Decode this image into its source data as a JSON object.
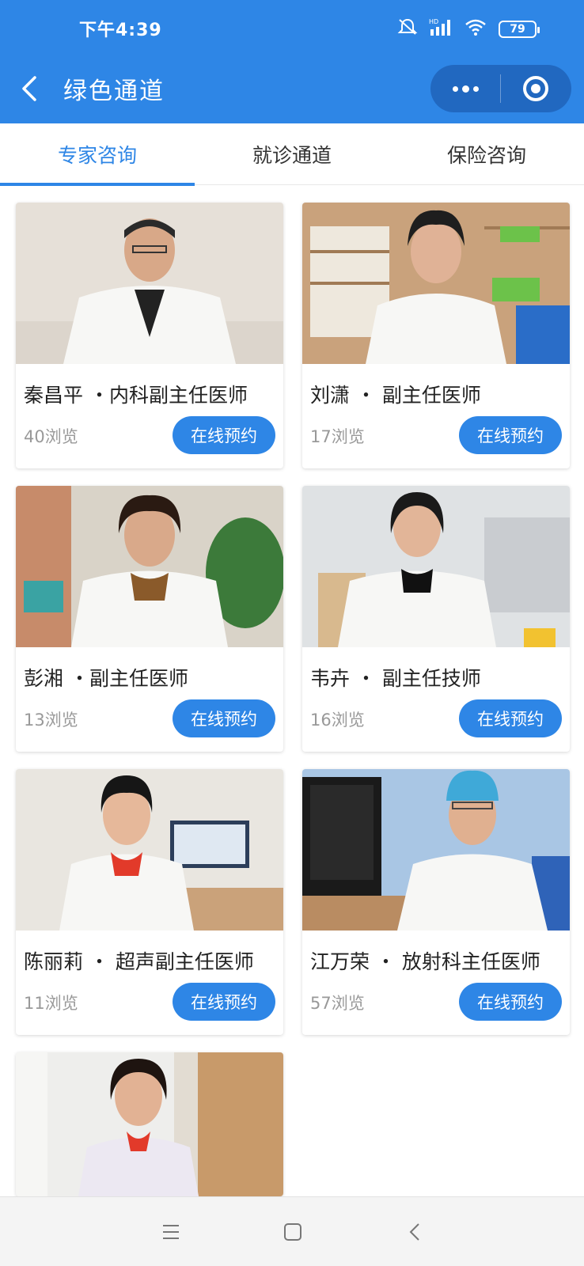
{
  "status_bar": {
    "time": "下午4:39",
    "battery": "79",
    "network_label": "HD"
  },
  "nav": {
    "title": "绿色通道"
  },
  "tabs": [
    {
      "label": "专家咨询",
      "active": true
    },
    {
      "label": "就诊通道",
      "active": false
    },
    {
      "label": "保险咨询",
      "active": false
    }
  ],
  "doctors": [
    {
      "name": "秦昌平 ・内科副主任医师",
      "views": "40浏览",
      "button": "在线预约"
    },
    {
      "name": "刘潇 ・ 副主任医师",
      "views": "17浏览",
      "button": "在线预约"
    },
    {
      "name": "彭湘 ・副主任医师",
      "views": "13浏览",
      "button": "在线预约"
    },
    {
      "name": "韦卉 ・ 副主任技师",
      "views": "16浏览",
      "button": "在线预约"
    },
    {
      "name": "陈丽莉 ・ 超声副主任医师",
      "views": "11浏览",
      "button": "在线预约"
    },
    {
      "name": "江万荣 ・ 放射科主任医师",
      "views": "57浏览",
      "button": "在线预约"
    }
  ],
  "colors": {
    "primary": "#2e86e6",
    "muted_text": "#999999",
    "name_text": "#222222"
  },
  "icons": {
    "back": "chevron-left-icon",
    "more": "more-dots-icon",
    "close": "target-ring-icon",
    "system_nav": [
      "menu-icon",
      "home-square-icon",
      "back-triangle-icon"
    ]
  }
}
